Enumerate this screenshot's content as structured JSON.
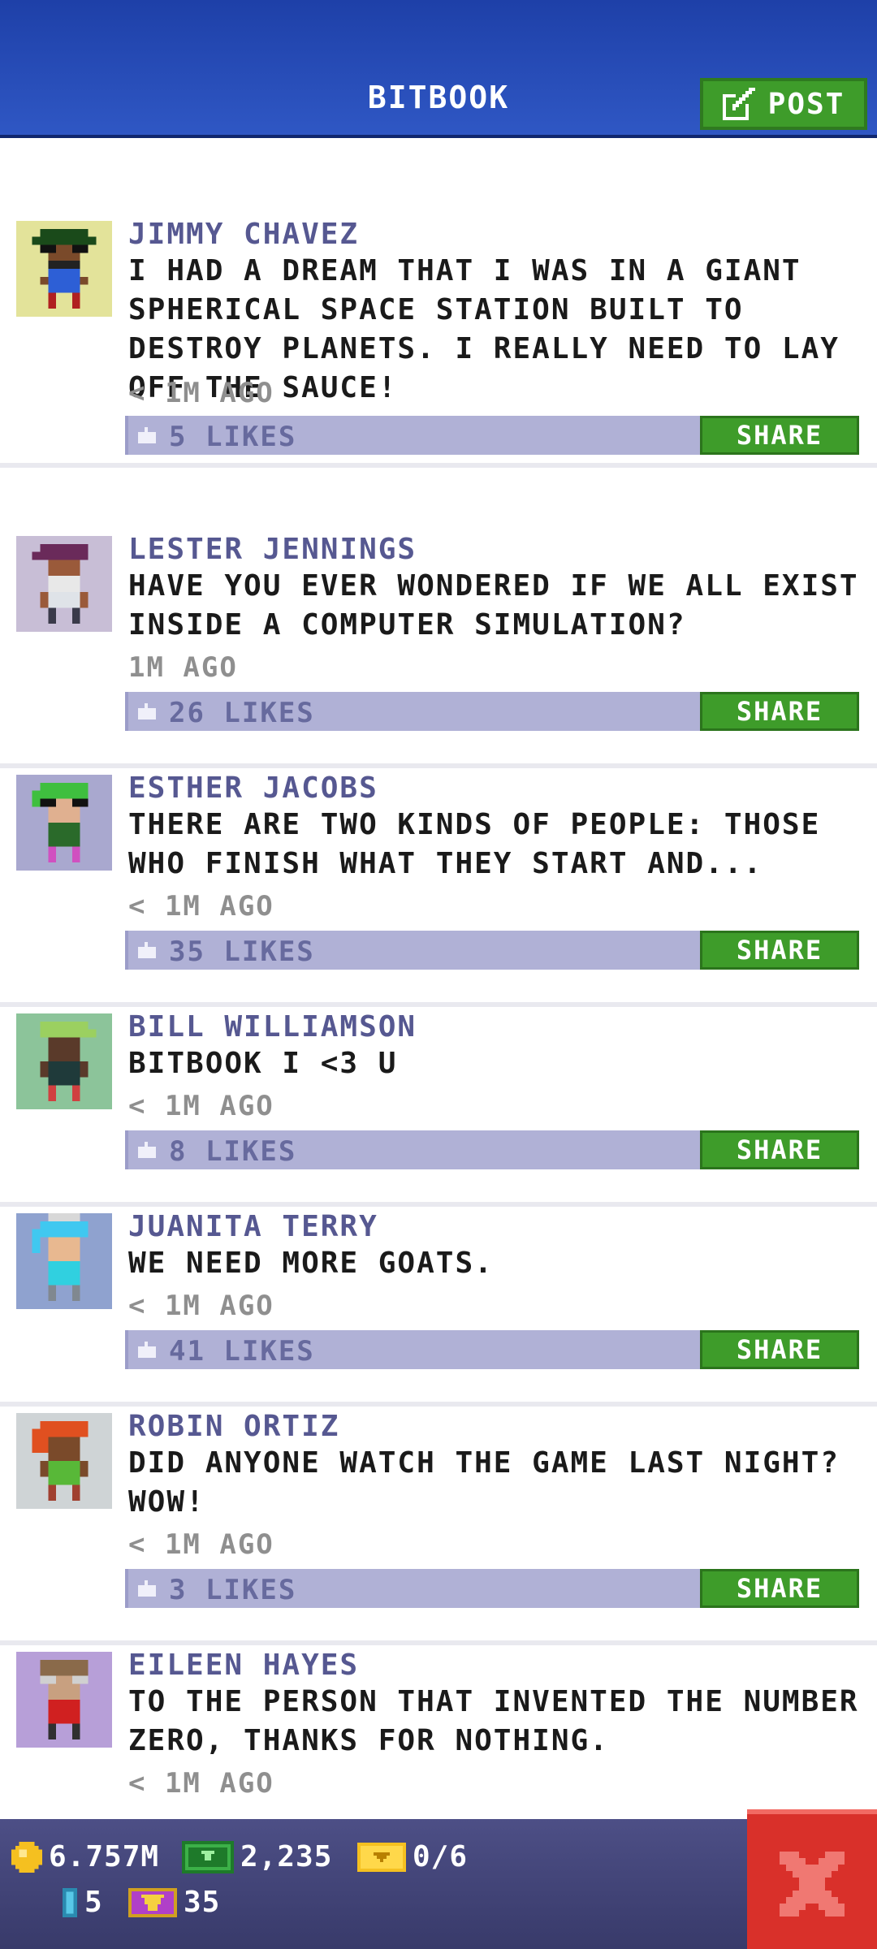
{
  "header": {
    "title": "BITBOOK",
    "post_label": "POST"
  },
  "posts": [
    {
      "name": "JIMMY CHAVEZ",
      "message": "I HAD A DREAM THAT I WAS IN A GIANT SPHERICAL SPACE STATION BUILT TO DESTROY PLANETS. I REALLY NEED TO LAY OFF THE SAUCE!",
      "time": "< 1M AGO",
      "likes": "5 LIKES",
      "share": "SHARE"
    },
    {
      "name": "LESTER JENNINGS",
      "message": "HAVE YOU EVER WONDERED IF WE ALL EXIST INSIDE A COMPUTER SIMULATION?",
      "time": "1M AGO",
      "likes": "26 LIKES",
      "share": "SHARE"
    },
    {
      "name": "ESTHER JACOBS",
      "message": "THERE ARE TWO KINDS OF PEOPLE: THOSE WHO FINISH WHAT THEY START AND...",
      "time": "< 1M AGO",
      "likes": "35 LIKES",
      "share": "SHARE"
    },
    {
      "name": "BILL WILLIAMSON",
      "message": "BITBOOK I <3 U",
      "time": "< 1M AGO",
      "likes": "8 LIKES",
      "share": "SHARE"
    },
    {
      "name": "JUANITA TERRY",
      "message": "WE NEED MORE GOATS.",
      "time": "< 1M AGO",
      "likes": "41 LIKES",
      "share": "SHARE"
    },
    {
      "name": "ROBIN ORTIZ",
      "message": "DID ANYONE WATCH THE GAME LAST NIGHT? WOW!",
      "time": "< 1M AGO",
      "likes": "3 LIKES",
      "share": "SHARE"
    },
    {
      "name": "EILEEN HAYES",
      "message": "TO THE PERSON THAT INVENTED THE NUMBER ZERO, THANKS FOR NOTHING.",
      "time": "< 1M AGO"
    }
  ],
  "status": {
    "coins": "6.757M",
    "bux": "2,235",
    "tickets": "0/6",
    "elevators": "5",
    "vip": "35"
  },
  "colors": {
    "header": "#2f57c4",
    "accent_green": "#3e9c2a",
    "like_bar": "#b0b1d6",
    "name": "#565891",
    "close": "#d9302a"
  }
}
